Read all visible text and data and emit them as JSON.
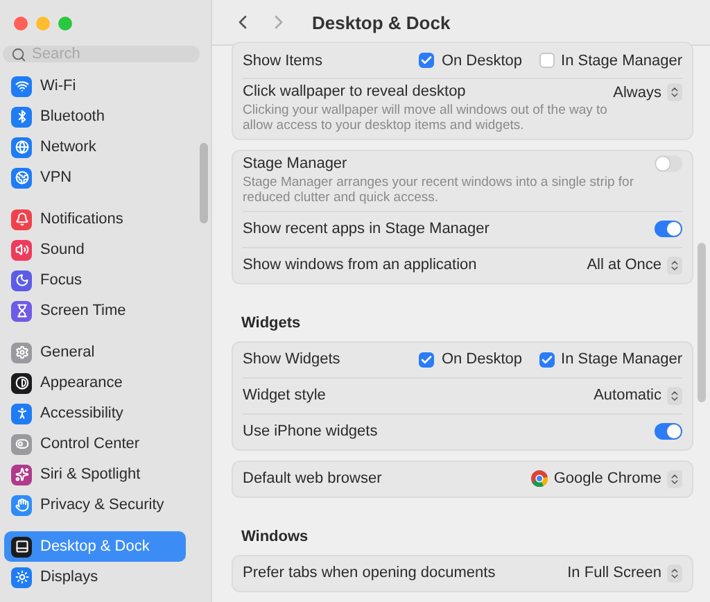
{
  "sidebar": {
    "search": {
      "placeholder": "Search"
    },
    "groups": [
      [
        {
          "label": "Wi-Fi",
          "color": "#1f7cf5",
          "selected": false
        },
        {
          "label": "Bluetooth",
          "color": "#1f7cf5",
          "selected": false
        },
        {
          "label": "Network",
          "color": "#1f7cf5",
          "selected": false
        },
        {
          "label": "VPN",
          "color": "#1f7cf5",
          "selected": false
        }
      ],
      [
        {
          "label": "Notifications",
          "color": "#f0424c",
          "selected": false
        },
        {
          "label": "Sound",
          "color": "#ee3b5d",
          "selected": false
        },
        {
          "label": "Focus",
          "color": "#5e5ce6",
          "selected": false
        },
        {
          "label": "Screen Time",
          "color": "#6e5ce6",
          "selected": false
        }
      ],
      [
        {
          "label": "General",
          "color": "#9a9a9e",
          "selected": false
        },
        {
          "label": "Appearance",
          "color": "#1c1c1e",
          "selected": false
        },
        {
          "label": "Accessibility",
          "color": "#1f7cf5",
          "selected": false
        },
        {
          "label": "Control Center",
          "color": "#9a9a9e",
          "selected": false
        },
        {
          "label": "Siri & Spotlight",
          "color": "#b03a8c",
          "selected": false
        },
        {
          "label": "Privacy & Security",
          "color": "#2f8cf7",
          "selected": false
        }
      ],
      [
        {
          "label": "Desktop & Dock",
          "color": "#1c1c1e",
          "selected": true
        },
        {
          "label": "Displays",
          "color": "#1f7cf5",
          "selected": false
        }
      ]
    ]
  },
  "header": {
    "title": "Desktop & Dock"
  },
  "sections": [
    {
      "cards": [
        [
          {
            "kind": "checks",
            "label": "Show Items",
            "options": [
              {
                "label": "On Desktop",
                "checked": true
              },
              {
                "label": "In Stage Manager",
                "checked": false
              }
            ]
          },
          {
            "kind": "popup",
            "label": "Click wallpaper to reveal desktop",
            "description": "Clicking your wallpaper will move all windows out of the way to allow access to your desktop items and widgets.",
            "value": "Always"
          }
        ],
        [
          {
            "kind": "toggle",
            "label": "Stage Manager",
            "description": "Stage Manager arranges your recent windows into a single strip for reduced clutter and quick access.",
            "on": false
          },
          {
            "kind": "toggle",
            "label": "Show recent apps in Stage Manager",
            "on": true
          },
          {
            "kind": "popup",
            "label": "Show windows from an application",
            "value": "All at Once"
          }
        ]
      ]
    },
    {
      "title": "Widgets",
      "cards": [
        [
          {
            "kind": "checks",
            "label": "Show Widgets",
            "options": [
              {
                "label": "On Desktop",
                "checked": true
              },
              {
                "label": "In Stage Manager",
                "checked": true
              }
            ]
          },
          {
            "kind": "popup",
            "label": "Widget style",
            "value": "Automatic"
          },
          {
            "kind": "toggle",
            "label": "Use iPhone widgets",
            "on": true
          }
        ],
        [
          {
            "kind": "browser",
            "label": "Default web browser",
            "value": "Google Chrome"
          }
        ]
      ]
    },
    {
      "title": "Windows",
      "cards": [
        [
          {
            "kind": "popup",
            "label": "Prefer tabs when opening documents",
            "value": "In Full Screen"
          }
        ]
      ]
    }
  ]
}
